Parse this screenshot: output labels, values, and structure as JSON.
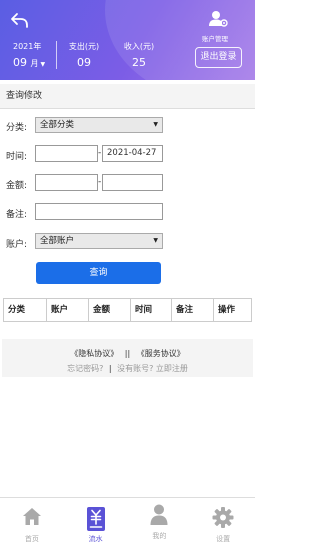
{
  "header": {
    "account_mgmt_label": "账户管理",
    "date": {
      "year_label": "2021年",
      "month_value": "09",
      "month_unit": "月",
      "caret": "▼"
    },
    "expense": {
      "label": "支出(元)",
      "value": "09"
    },
    "income": {
      "label": "收入(元)",
      "value": "25"
    },
    "logout_label": "退出登录"
  },
  "section_title": "查询修改",
  "form": {
    "category": {
      "label": "分类:",
      "value": "全部分类",
      "arrow": "▼"
    },
    "time": {
      "label": "时间:",
      "start_value": "",
      "separator": "-",
      "end_value": "2021-04-27"
    },
    "amount": {
      "label": "金额:",
      "min_value": "",
      "separator": "-",
      "max_value": ""
    },
    "note": {
      "label": "备注:",
      "value": ""
    },
    "account": {
      "label": "账户:",
      "value": "全部账户",
      "arrow": "▼"
    },
    "query_label": "查询"
  },
  "table": {
    "headers": [
      "分类",
      "账户",
      "金额",
      "时间",
      "备注",
      "操作"
    ]
  },
  "footer": {
    "privacy": "《隐私协议》",
    "divider": "||",
    "service": "《服务协议》",
    "forgot": "忘记密码?",
    "pipe": "|",
    "no_account": "没有账号?",
    "register": "立即注册"
  },
  "nav": [
    {
      "label": "首页",
      "icon": "home-icon",
      "active": false
    },
    {
      "label": "流水",
      "icon": "bill-icon",
      "active": true
    },
    {
      "label": "我的",
      "icon": "user-icon",
      "active": false
    },
    {
      "label": "设置",
      "icon": "gear-icon",
      "active": false
    }
  ],
  "colors": {
    "accent": "#1b6ee8",
    "header_start": "#5a5ee3",
    "header_end": "#a57be8",
    "nav_active": "#5a52d6"
  }
}
